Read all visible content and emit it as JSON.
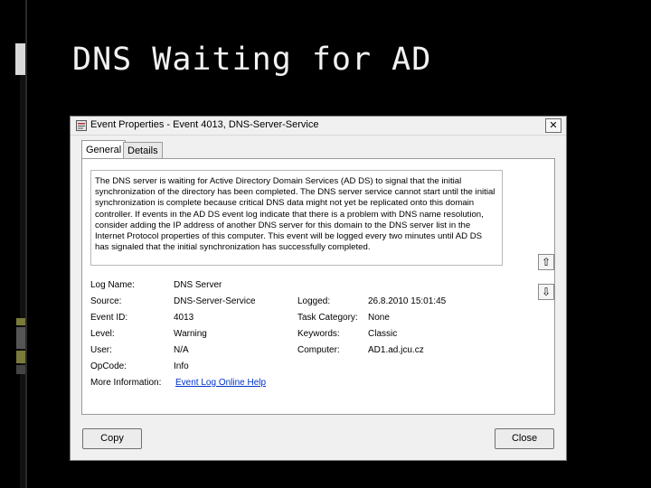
{
  "slide": {
    "title": "DNS Waiting for AD"
  },
  "dialog": {
    "title": "Event Properties - Event 4013, DNS-Server-Service",
    "close_glyph": "✕",
    "tabs": [
      {
        "label": "General"
      },
      {
        "label": "Details"
      }
    ],
    "description": "The DNS server is waiting for Active Directory Domain Services (AD DS) to signal that the initial synchronization of the directory has been completed. The DNS server service cannot start until the initial synchronization is complete because critical DNS data might not yet be replicated onto this domain controller. If events in the AD DS event log indicate that there is a problem with DNS name resolution, consider adding the IP address of another DNS server for this domain to the DNS server list in the Internet Protocol properties of this computer. This event will be logged every two minutes until AD DS has signaled that the initial synchronization has successfully completed.",
    "fields": {
      "log_name": {
        "label": "Log Name:",
        "value": "DNS Server"
      },
      "source": {
        "label": "Source:",
        "value": "DNS-Server-Service"
      },
      "logged": {
        "label": "Logged:",
        "value": "26.8.2010 15:01:45"
      },
      "event_id": {
        "label": "Event ID:",
        "value": "4013"
      },
      "task_category": {
        "label": "Task Category:",
        "value": "None"
      },
      "level": {
        "label": "Level:",
        "value": "Warning"
      },
      "keywords": {
        "label": "Keywords:",
        "value": "Classic"
      },
      "user": {
        "label": "User:",
        "value": "N/A"
      },
      "computer": {
        "label": "Computer:",
        "value": "AD1.ad.jcu.cz"
      },
      "opcode": {
        "label": "OpCode:",
        "value": "Info"
      },
      "more_info": {
        "label": "More Information:",
        "value": "Event Log Online Help"
      }
    },
    "nav": {
      "up_glyph": "⇧",
      "down_glyph": "⇩"
    },
    "buttons": {
      "copy": "Copy",
      "close": "Close"
    }
  },
  "colors": {
    "slide_bg": "#000000",
    "dialog_bg": "#f0f0f0",
    "link": "#0033cc"
  }
}
